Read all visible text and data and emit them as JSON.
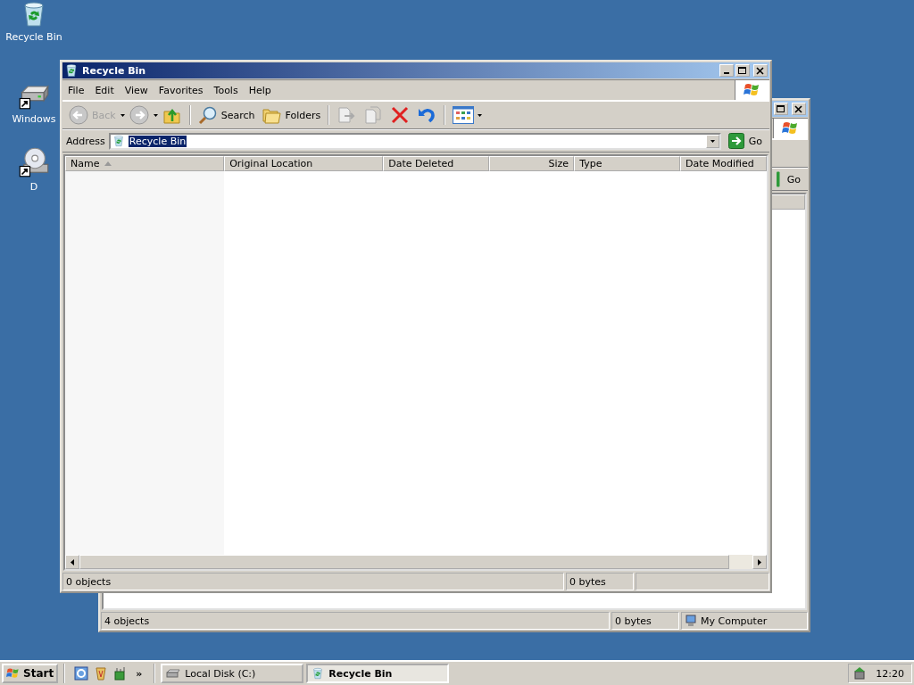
{
  "desktop_icons": [
    {
      "label": "Recycle Bin",
      "kind": "recycle"
    },
    {
      "label": "Windows",
      "kind": "drive"
    },
    {
      "label": "D",
      "kind": "cd"
    }
  ],
  "back_window": {
    "go": "Go",
    "status_bar": [
      "4 objects",
      "0 bytes",
      "My Computer"
    ]
  },
  "window": {
    "title": "Recycle Bin",
    "menu": [
      "File",
      "Edit",
      "View",
      "Favorites",
      "Tools",
      "Help"
    ],
    "toolbar": {
      "back": {
        "label": "Back",
        "disabled": true
      },
      "search": "Search",
      "folders": "Folders"
    },
    "address": {
      "label": "Address",
      "value": "Recycle Bin",
      "selected": true,
      "go": "Go"
    },
    "columns": [
      {
        "label": "Name",
        "sorted": true,
        "kind": "text"
      },
      {
        "label": "Original Location",
        "sorted": false,
        "kind": "text"
      },
      {
        "label": "Date Deleted",
        "sorted": false,
        "kind": "text"
      },
      {
        "label": "Size",
        "sorted": false,
        "kind": "number"
      },
      {
        "label": "Type",
        "sorted": false,
        "kind": "text"
      },
      {
        "label": "Date Modified",
        "sorted": false,
        "kind": "text"
      }
    ],
    "status_bar": [
      "0 objects",
      "0 bytes"
    ]
  },
  "taskbar": {
    "start": "Start",
    "more": "»",
    "tasks": [
      {
        "label": "Local Disk (C:)",
        "selected": false,
        "kind": "drive"
      },
      {
        "label": "Recycle Bin",
        "selected": true,
        "kind": "recycle"
      }
    ],
    "clock": "12:20"
  }
}
